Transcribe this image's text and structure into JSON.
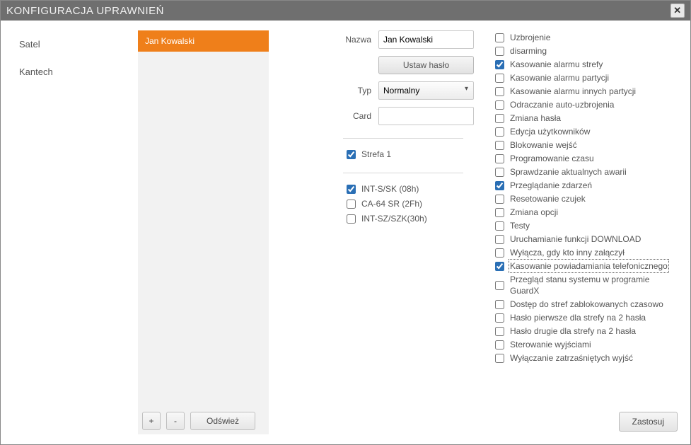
{
  "window": {
    "title": "KONFIGURACJA UPRAWNIEŃ"
  },
  "providers": [
    {
      "label": "Satel",
      "selected": true
    },
    {
      "label": "Kantech",
      "selected": false
    }
  ],
  "users": [
    {
      "label": "Jan Kowalski",
      "selected": true
    }
  ],
  "usersToolbar": {
    "add": "+",
    "remove": "-",
    "refresh": "Odśwież"
  },
  "form": {
    "nameLabel": "Nazwa",
    "nameValue": "Jan Kowalski",
    "passwordButton": "Ustaw hasło",
    "typeLabel": "Typ",
    "typeValue": "Normalny",
    "cardLabel": "Card",
    "cardValue": ""
  },
  "zones": [
    {
      "label": "Strefa  1",
      "checked": true
    }
  ],
  "devices": [
    {
      "label": "INT-S/SK  (08h)",
      "checked": true
    },
    {
      "label": "CA-64 SR   (2Fh)",
      "checked": false
    },
    {
      "label": "INT-SZ/SZK(30h)",
      "checked": false
    }
  ],
  "permissions": [
    {
      "label": "Uzbrojenie",
      "checked": false
    },
    {
      "label": "disarming",
      "checked": false
    },
    {
      "label": "Kasowanie alarmu strefy",
      "checked": true
    },
    {
      "label": "Kasowanie alarmu partycji",
      "checked": false
    },
    {
      "label": "Kasowanie alarmu innych partycji",
      "checked": false
    },
    {
      "label": "Odraczanie auto-uzbrojenia",
      "checked": false
    },
    {
      "label": "Zmiana hasła",
      "checked": false
    },
    {
      "label": "Edycja użytkowników",
      "checked": false
    },
    {
      "label": "Blokowanie wejść",
      "checked": false
    },
    {
      "label": "Programowanie czasu",
      "checked": false
    },
    {
      "label": "Sprawdzanie aktualnych awarii",
      "checked": false
    },
    {
      "label": "Przeglądanie zdarzeń",
      "checked": true
    },
    {
      "label": "Resetowanie czujek",
      "checked": false
    },
    {
      "label": "Zmiana opcji",
      "checked": false
    },
    {
      "label": "Testy",
      "checked": false
    },
    {
      "label": "Uruchamianie funkcji DOWNLOAD",
      "checked": false
    },
    {
      "label": "Wyłącza, gdy kto inny załączył",
      "checked": false
    },
    {
      "label": "Kasowanie powiadamiania telefonicznego",
      "checked": true,
      "focused": true
    },
    {
      "label": "Przegląd stanu systemu w programie GuardX",
      "checked": false
    },
    {
      "label": "Dostęp do stref zablokowanych czasowo",
      "checked": false
    },
    {
      "label": "Hasło pierwsze dla strefy na 2 hasła",
      "checked": false
    },
    {
      "label": "Hasło drugie dla strefy na 2 hasła",
      "checked": false
    },
    {
      "label": "Sterowanie wyjściami",
      "checked": false
    },
    {
      "label": "Wyłączanie zatrzaśniętych wyjść",
      "checked": false
    }
  ],
  "buttons": {
    "apply": "Zastosuj"
  }
}
